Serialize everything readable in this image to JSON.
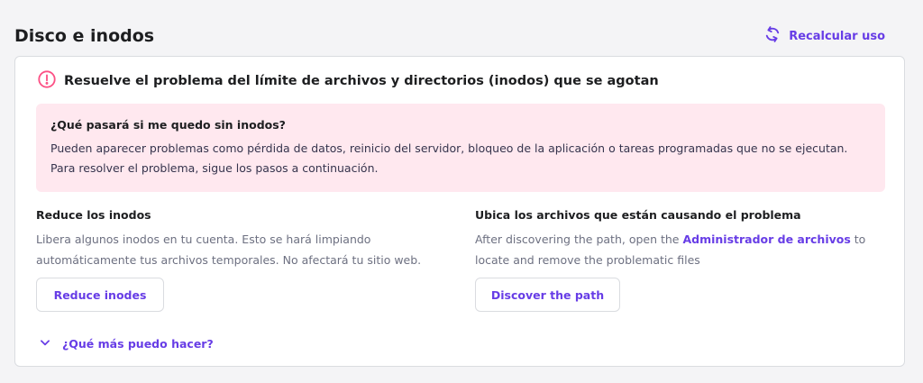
{
  "header": {
    "title": "Disco e inodos",
    "recalc_label": "Recalcular uso"
  },
  "alert": {
    "title": "Resuelve el problema del límite de archivos y directorios (inodos) que se agotan",
    "question": "¿Qué pasará si me quedo sin inodos?",
    "text": "Pueden aparecer problemas como pérdida de datos, reinicio del servidor, bloqueo de la aplicación o tareas programadas que no se ejecutan. Para resolver el problema, sigue los pasos a continuación."
  },
  "left": {
    "title": "Reduce los inodos",
    "text": "Libera algunos inodos en tu cuenta. Esto se hará limpiando automáticamente tus archivos temporales. No afectará tu sitio web.",
    "button": "Reduce inodes"
  },
  "right": {
    "title": "Ubica los archivos que están causando el problema",
    "text_before": "After discovering the path, open the ",
    "link": "Administrador de archivos",
    "text_after": " to locate and remove the problematic files",
    "button": "Discover the path"
  },
  "more": {
    "label": "¿Qué más puedo hacer?"
  },
  "colors": {
    "accent": "#673de6",
    "warning_bg": "#ffe8ef",
    "alert_icon": "#fc5185"
  }
}
